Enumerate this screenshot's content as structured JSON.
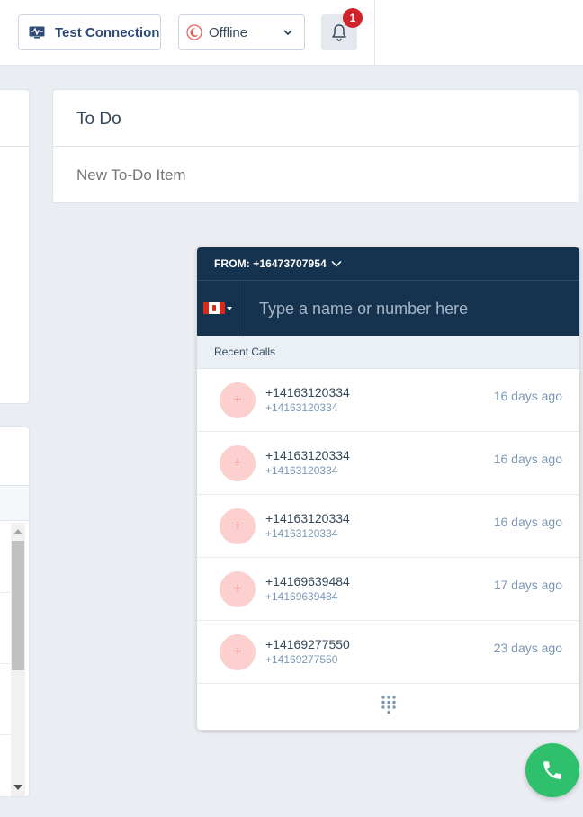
{
  "header": {
    "test_connection_label": "Test Connection",
    "status": {
      "selected": "Offline"
    },
    "notifications": {
      "count": "1"
    }
  },
  "todo": {
    "title": "To Do",
    "new_item_placeholder": "New To-Do Item"
  },
  "dialer": {
    "from_label": "FROM: +16473707954",
    "country": "CA",
    "input_placeholder": "Type a name or number here",
    "recent_calls_label": "Recent Calls",
    "recent_calls": [
      {
        "number": "+14163120334",
        "subnumber": "+14163120334",
        "when": "16 days ago"
      },
      {
        "number": "+14163120334",
        "subnumber": "+14163120334",
        "when": "16 days ago"
      },
      {
        "number": "+14163120334",
        "subnumber": "+14163120334",
        "when": "16 days ago"
      },
      {
        "number": "+14169639484",
        "subnumber": "+14169639484",
        "when": "17 days ago"
      },
      {
        "number": "+14169277550",
        "subnumber": "+14169277550",
        "when": "23 days ago"
      }
    ],
    "avatar_glyph": "+"
  },
  "colors": {
    "header_bg": "#15324f",
    "accent_blue": "#2d4a78",
    "badge_red": "#d0222a",
    "call_green": "#2ec06c",
    "avatar_bg": "#fdd0d0"
  },
  "icons": {
    "test_connection": "pulse-monitor-icon",
    "status": "moon-icon",
    "notifications": "bell-icon",
    "keypad": "keypad-icon",
    "call": "phone-icon"
  }
}
